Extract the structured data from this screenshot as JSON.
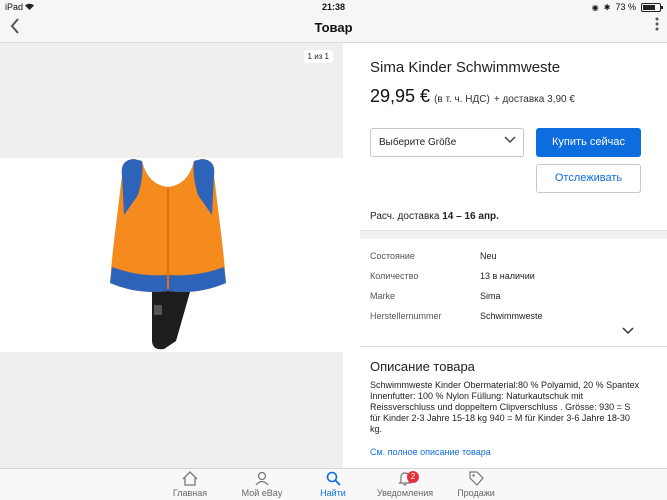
{
  "status_bar": {
    "carrier": "iPad",
    "time": "21:38",
    "battery": "73 %",
    "battery_level": 0.73
  },
  "nav": {
    "title": "Товар",
    "back_icon": "chevron-left-icon",
    "more_icon": "more-vertical-icon"
  },
  "gallery": {
    "counter": "1 из 1"
  },
  "product": {
    "title": "Sima Kinder Schwimmweste",
    "price": "29,95 €",
    "vat": "(в т. ч. НДС)",
    "shipping": "+ доставка 3,90 €",
    "size_select_label": "Выберите Größe",
    "buy_label": "Купить сейчас",
    "watch_label": "Отслеживать",
    "delivery_label": "Расч. доставка",
    "delivery_dates": "14 – 16 апр."
  },
  "specs": [
    {
      "key": "Состояние",
      "value": "Neu"
    },
    {
      "key": "Количество",
      "value": "13 в наличии"
    },
    {
      "key": "Marke",
      "value": "Sima"
    },
    {
      "key": "Herstellernummer",
      "value": "Schwimmweste"
    }
  ],
  "description": {
    "title": "Описание товара",
    "text": "Schwimmweste Kinder Obermaterial:80 % Polyamid, 20 % Spantex Innenfutter: 100 % Nylon Füllung: Naturkautschuk mit Reissverschluss und doppeltem  Clipverschluss . Grösse: 930 = S für Kinder 2-3 Jahre 15-18 kg 940 = M für Kinder 3-6 Jahre 18-30 kg.",
    "link": "См. полное описание товара"
  },
  "tabs": [
    {
      "label": "Главная",
      "icon": "home-icon"
    },
    {
      "label": "Мой eBay",
      "icon": "user-icon"
    },
    {
      "label": "Найти",
      "icon": "search-icon",
      "active": true
    },
    {
      "label": "Уведомления",
      "icon": "bell-icon",
      "badge": "2"
    },
    {
      "label": "Продажи",
      "icon": "tag-icon"
    }
  ]
}
